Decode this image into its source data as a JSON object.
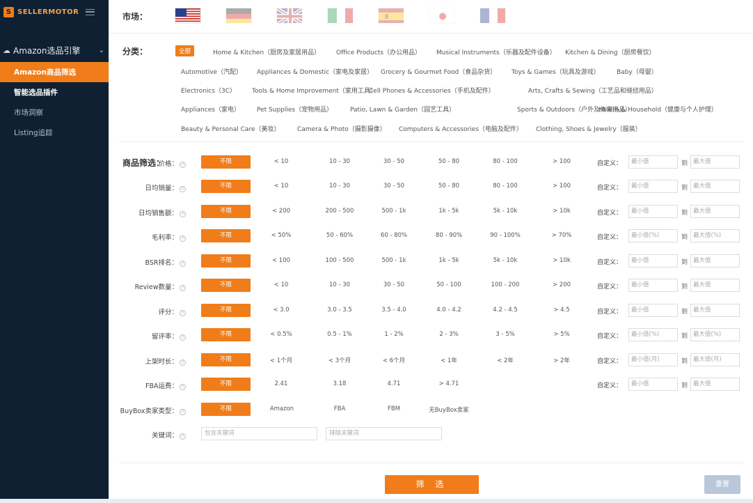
{
  "brand": {
    "mark": "S",
    "name": "SELLERMOTOR"
  },
  "sidebar": {
    "group_label": "Amazon选品引擎",
    "items": [
      "Amazon商品筛选",
      "智能选品插件",
      "市场洞察",
      "Listing追踪"
    ]
  },
  "market": {
    "label": "市场：",
    "flags": [
      "us-flag",
      "de-flag",
      "uk-flag",
      "it-flag",
      "es-flag",
      "jp-flag",
      "fr-flag"
    ]
  },
  "categories": {
    "label": "分类：",
    "rows": [
      [
        "全部",
        "Home & Kitchen（厨房及家居用品）",
        "Office Products（办公用品）",
        "Musical Instruments（乐器及配件设备）",
        "Kitchen & Dining（厨房餐饮）"
      ],
      [
        "Automotive（汽配）",
        "Appliances & Domestic（家电及家居）",
        "Grocery & Gourmet Food（食品杂货）",
        "Toys & Games（玩具及游戏）",
        "Baby（母婴）"
      ],
      [
        "Electronics（3C）",
        "Tools & Home Improvement（家用工具）",
        "Cell Phones & Accessories（手机及配件）",
        "Arts, Crafts & Sewing（工艺品和缝纫用品）"
      ],
      [
        "Appliances（家电）",
        "Pet Supplies（宠物用品）",
        "Patio, Lawn & Garden（园艺工具）",
        "Sports & Outdoors（户外及体育用品）",
        "Health & Household（健康与个人护理）"
      ],
      [
        "Beauty & Personal Care（美妆）",
        "Camera & Photo（摄影摄像）",
        "Computers & Accessories（电脑及配件）",
        "Clothing, Shoes & Jewelry（服装）"
      ]
    ]
  },
  "filters": {
    "section_label": "商品筛选：",
    "unlimited_label": "不限",
    "custom_label": "自定义",
    "to_label": "到",
    "rows": [
      {
        "label": "价格",
        "options": [
          "< 10",
          "10 - 30",
          "30 - 50",
          "50 - 80",
          "80 - 100",
          "> 100"
        ],
        "min": "最小值",
        "max": "最大值"
      },
      {
        "label": "日均销量",
        "options": [
          "< 10",
          "10 - 30",
          "30 - 50",
          "50 - 80",
          "80 - 100",
          "> 100"
        ],
        "min": "最小值",
        "max": "最大值"
      },
      {
        "label": "日均销售额",
        "options": [
          "< 200",
          "200 - 500",
          "500 - 1k",
          "1k - 5k",
          "5k - 10k",
          "> 10k"
        ],
        "min": "最小值",
        "max": "最大值"
      },
      {
        "label": "毛利率",
        "options": [
          "< 50%",
          "50 - 60%",
          "60 - 80%",
          "80 - 90%",
          "90 - 100%",
          "> 70%"
        ],
        "min": "最小值(%)",
        "max": "最大值(%)"
      },
      {
        "label": "BSR排名",
        "options": [
          "< 100",
          "100 - 500",
          "500 - 1k",
          "1k - 5k",
          "5k - 10k",
          "> 10k"
        ],
        "min": "最小值",
        "max": "最大值"
      },
      {
        "label": "Review数量",
        "options": [
          "< 10",
          "10 - 30",
          "30 - 50",
          "50 - 100",
          "100 - 200",
          "> 200"
        ],
        "min": "最小值",
        "max": "最大值"
      },
      {
        "label": "评分",
        "options": [
          "< 3.0",
          "3.0 - 3.5",
          "3.5 - 4.0",
          "4.0 - 4.2",
          "4.2 - 4.5",
          "> 4.5"
        ],
        "min": "最小值",
        "max": "最大值"
      },
      {
        "label": "留评率",
        "options": [
          "< 0.5%",
          "0.5 - 1%",
          "1 - 2%",
          "2 - 3%",
          "3 - 5%",
          "> 5%"
        ],
        "min": "最小值(%)",
        "max": "最大值(%)"
      },
      {
        "label": "上架时长",
        "options": [
          "< 1个月",
          "< 3个月",
          "< 6个月",
          "< 1年",
          "< 2年",
          "> 2年"
        ],
        "min": "最小值(月)",
        "max": "最大值(月)"
      },
      {
        "label": "FBA运费",
        "options": [
          "2.41",
          "3.18",
          "4.71",
          "> 4.71"
        ],
        "min": "最小值",
        "max": "最大值"
      },
      {
        "label": "BuyBox卖家类型",
        "options": [
          "Amazon",
          "FBA",
          "FBM",
          "无BuyBox卖家"
        ]
      }
    ],
    "keyword_label": "关键词",
    "keyword_include_placeholder": "包含关键词",
    "keyword_exclude_placeholder": "排除关键词"
  },
  "actions": {
    "filter": "筛 选",
    "reset": "重置"
  },
  "colors": {
    "accent": "#f07d1a",
    "sidebar_bg": "#0f2033",
    "reset_bg": "#b9c7db"
  }
}
